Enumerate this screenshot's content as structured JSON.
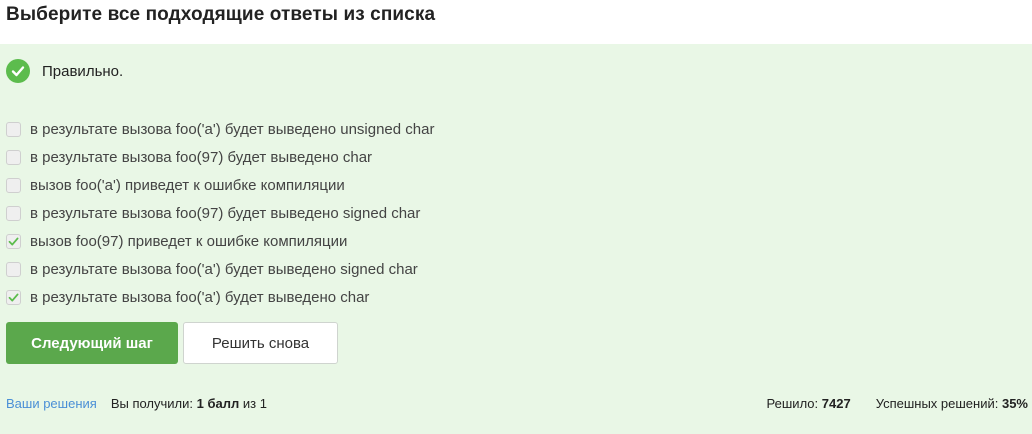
{
  "header": {
    "title": "Выберите все подходящие ответы из списка"
  },
  "result": {
    "icon": "check-circle-icon",
    "text": "Правильно.",
    "color": "#5cbc4d"
  },
  "options": [
    {
      "label": "в результате вызова foo('a') будет выведено unsigned char",
      "checked": false
    },
    {
      "label": "в результате вызова foo(97) будет выведено char",
      "checked": false
    },
    {
      "label": "вызов foo('a') приведет к ошибке компиляции",
      "checked": false
    },
    {
      "label": "в результате вызова foo(97) будет выведено signed char",
      "checked": false
    },
    {
      "label": "вызов foo(97) приведет к ошибке компиляции",
      "checked": true
    },
    {
      "label": "в результате вызова foo('a') будет выведено signed char",
      "checked": false
    },
    {
      "label": "в результате вызова foo('a') будет выведено char",
      "checked": true
    }
  ],
  "buttons": {
    "next_label": "Следующий шаг",
    "retry_label": "Решить снова"
  },
  "footer": {
    "solutions_link": "Ваши решения",
    "score_prefix": "Вы получили:",
    "score_value": "1 балл",
    "score_suffix": "из 1",
    "solved_label": "Решило:",
    "solved_value": "7427",
    "success_label": "Успешных решений:",
    "success_value": "35%"
  },
  "colors": {
    "panel_bg": "#e9f7e6",
    "primary_button": "#5ba84c",
    "link": "#4a8fd6"
  }
}
